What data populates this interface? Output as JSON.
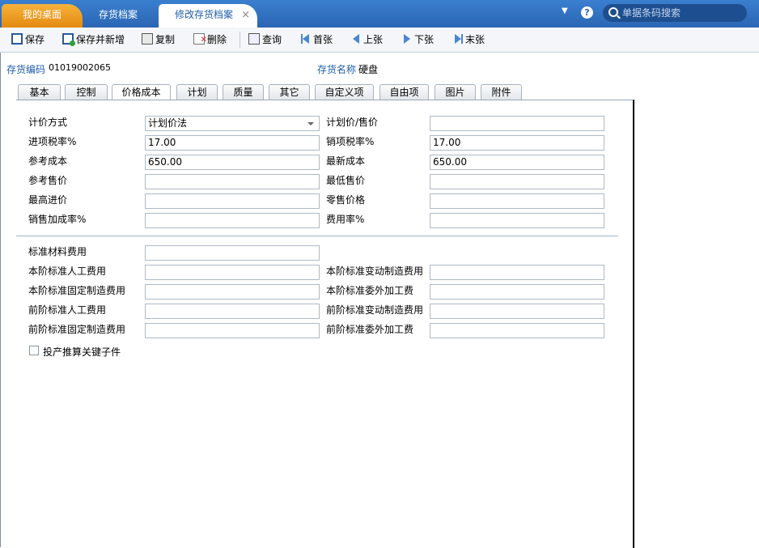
{
  "top_tabs": {
    "home": "我的桌面",
    "archive": "存货档案",
    "edit": "修改存货档案",
    "close": "×"
  },
  "search": {
    "placeholder": "单据条码搜索"
  },
  "help": "?",
  "dropdown_arrow": "▼",
  "toolbar": {
    "save": "保存",
    "save_new": "保存并新增",
    "copy": "复制",
    "delete": "删除",
    "query": "查询",
    "first": "首张",
    "prev": "上张",
    "next": "下张",
    "last": "末张"
  },
  "header": {
    "code_label": "存货编码",
    "code_value": "01019002065",
    "name_label": "存货名称",
    "name_value": "硬盘"
  },
  "form_tabs": [
    "基本",
    "控制",
    "价格成本",
    "计划",
    "质量",
    "其它",
    "自定义项",
    "自由项",
    "图片",
    "附件"
  ],
  "active_tab": "价格成本",
  "fields": {
    "pricing_method_label": "计价方式",
    "pricing_method_value": "计划价法",
    "plan_price_label": "计划价/售价",
    "plan_price_value": "",
    "input_tax_label": "进项税率%",
    "input_tax_value": "17.00",
    "output_tax_label": "销项税率%",
    "output_tax_value": "17.00",
    "ref_cost_label": "参考成本",
    "ref_cost_value": "650.00",
    "latest_cost_label": "最新成本",
    "latest_cost_value": "650.00",
    "ref_price_label": "参考售价",
    "ref_price_value": "",
    "min_price_label": "最低售价",
    "min_price_value": "",
    "max_purchase_label": "最高进价",
    "max_purchase_value": "",
    "retail_price_label": "零售价格",
    "retail_price_value": "",
    "markup_label": "销售加成率%",
    "markup_value": "",
    "expense_rate_label": "费用率%",
    "expense_rate_value": "",
    "std_material_label": "标准材料费用",
    "std_material_value": "",
    "cur_labor_label": "本阶标准人工费用",
    "cur_labor_value": "",
    "cur_var_label": "本阶标准变动制造费用",
    "cur_var_value": "",
    "cur_fixed_label": "本阶标准固定制造费用",
    "cur_fixed_value": "",
    "cur_outsource_label": "本阶标准委外加工费",
    "cur_outsource_value": "",
    "prev_labor_label": "前阶标准人工费用",
    "prev_labor_value": "",
    "prev_var_label": "前阶标准变动制造费用",
    "prev_var_value": "",
    "prev_fixed_label": "前阶标准固定制造费用",
    "prev_fixed_value": "",
    "prev_outsource_label": "前阶标准委外加工费",
    "prev_outsource_value": ""
  },
  "checkbox": {
    "label": "投产推算关键子件",
    "checked": false
  }
}
